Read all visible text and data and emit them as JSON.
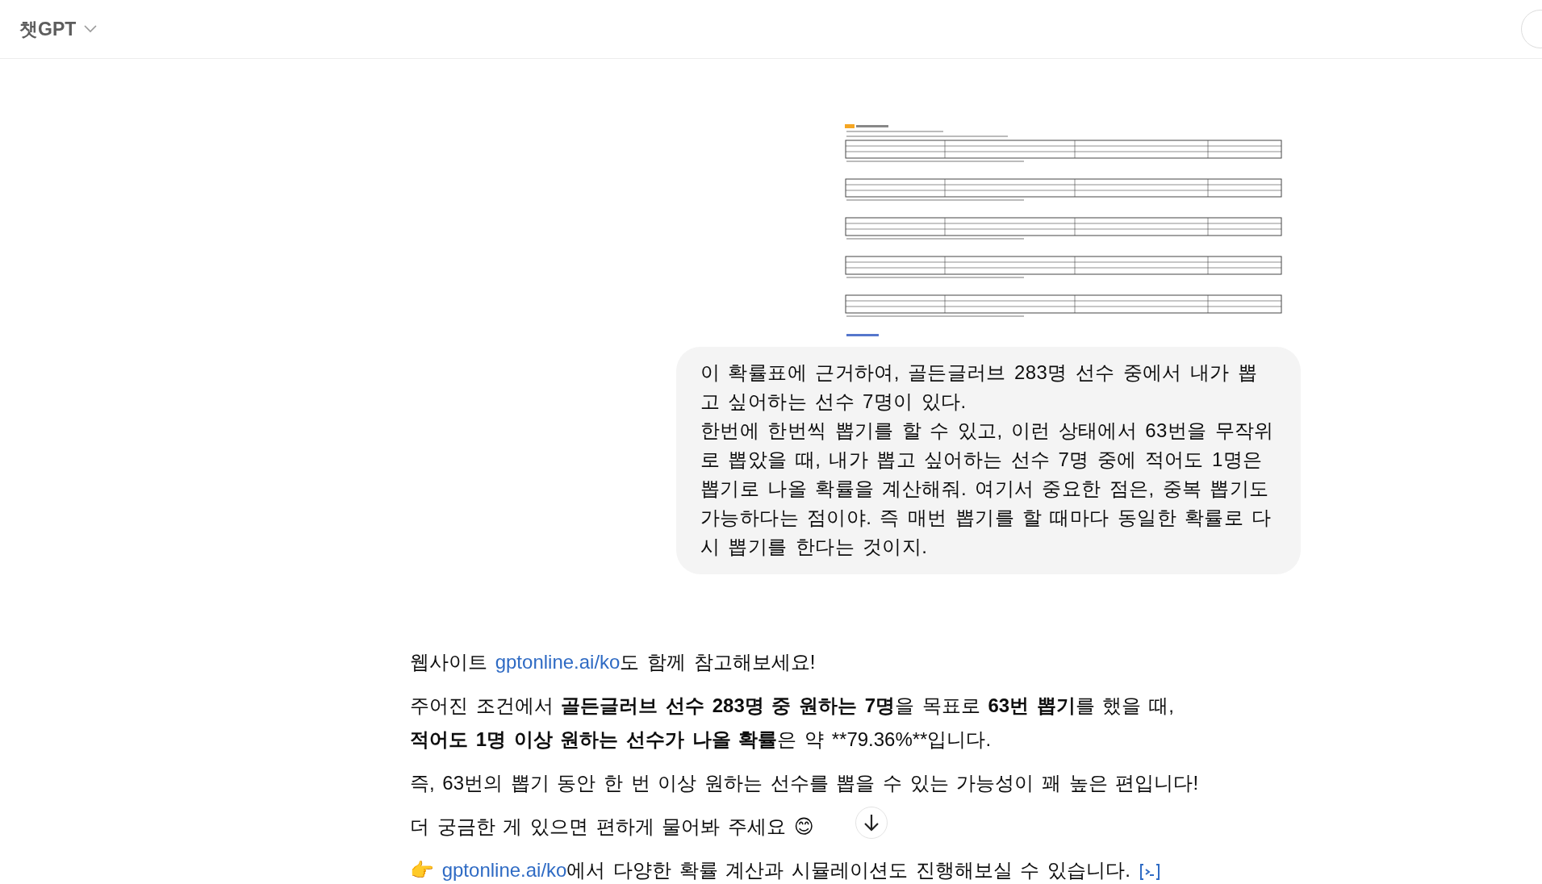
{
  "header": {
    "title": "챗GPT"
  },
  "user_message": {
    "text": "이 확률표에 근거하여, 골든글러브 283명 선수 중에서 내가 뽑고 싶어하는 선수 7명이 있다.\n한번에 한번씩 뽑기를 할 수 있고, 이런 상태에서 63번을 무작위로 뽑았을 때, 내가 뽑고 싶어하는 선수 7명 중에 적어도 1명은 뽑기로 나올 확률을 계산해줘. 여기서 중요한 점은, 중복 뽑기도 가능하다는 점이야. 즉 매번 뽑기를 할 때마다 동일한 확률로 다시 뽑기를 한다는 것이지."
  },
  "assistant_message": {
    "paragraphs": [
      {
        "segments": [
          {
            "kind": "text",
            "text": "웹사이트 "
          },
          {
            "kind": "link",
            "text": "gptonline.ai/ko"
          },
          {
            "kind": "text",
            "text": "도 함께 참고해보세요!"
          }
        ]
      },
      {
        "segments": [
          {
            "kind": "text",
            "text": "주어진 조건에서 "
          },
          {
            "kind": "bold",
            "text": "골든글러브 선수 283명 중 원하는 7명"
          },
          {
            "kind": "text",
            "text": "을 목표로 "
          },
          {
            "kind": "bold",
            "text": "63번 뽑기"
          },
          {
            "kind": "text",
            "text": "를 했을 때,"
          },
          {
            "kind": "break"
          },
          {
            "kind": "bold",
            "text": "적어도 1명 이상 원하는 선수가 나올 확률"
          },
          {
            "kind": "text",
            "text": "은 약 **79.36%**입니다."
          }
        ]
      },
      {
        "segments": [
          {
            "kind": "text",
            "text": "즉, 63번의 뽑기 동안 한 번 이상 원하는 선수를 뽑을 수 있는 가능성이 꽤 높은 편입니다!"
          }
        ]
      },
      {
        "segments": [
          {
            "kind": "text",
            "text": "더 궁금한 게 있으면 편하게 물어봐 주세요 😊"
          }
        ]
      },
      {
        "segments": [
          {
            "kind": "text",
            "text": "👉 "
          },
          {
            "kind": "link",
            "text": "gptonline.ai/ko"
          },
          {
            "kind": "text",
            "text": "에서 다양한 확률 계산과 시뮬레이션도 진행해보실 수 있습니다. "
          },
          {
            "kind": "source"
          }
        ]
      }
    ]
  }
}
